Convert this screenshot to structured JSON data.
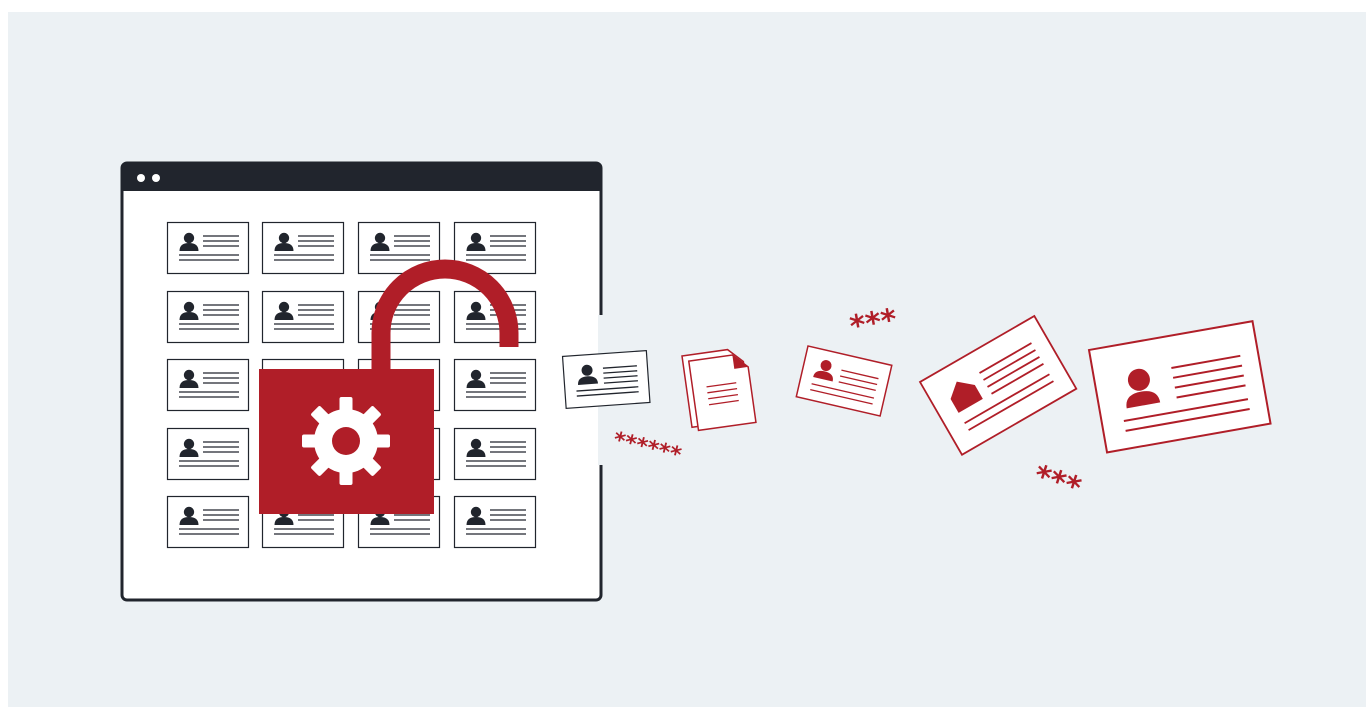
{
  "illustration": {
    "subject": "data-leak",
    "icons": {
      "lock": "unlocked-padlock-icon",
      "gear": "gear-icon",
      "profile_card": "profile-card-icon",
      "document": "document-icon",
      "home": "home-icon"
    },
    "colors": {
      "background": "#ecf1f4",
      "window_bar": "#21252d",
      "window_body": "#ffffff",
      "accent": "#b01e28",
      "card_stroke": "#21252d"
    },
    "browser_window": {
      "grid_rows": 5,
      "grid_columns": 4
    },
    "masked_texts": {
      "near_window": "******",
      "above_cards": "***",
      "below_cards": "***"
    }
  }
}
